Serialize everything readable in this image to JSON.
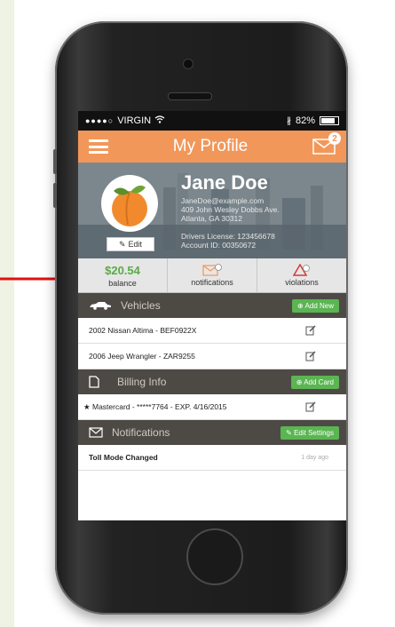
{
  "status_bar": {
    "signal": "●●●●○",
    "carrier": "VIRGIN",
    "battery": "82%"
  },
  "nav": {
    "title": "My Profile",
    "mail_badge": "2"
  },
  "profile": {
    "name": "Jane Doe",
    "email": "JaneDoe@example.com",
    "address_line1": "409 John Wesley Dobbs Ave.",
    "address_line2": "Atlanta, GA 30312",
    "license": "Drivers License: 123456678",
    "account": "Account ID: 00350672",
    "edit_label": "Edit"
  },
  "stats": [
    {
      "value": "$20.54",
      "label": "balance"
    },
    {
      "label": "notifications"
    },
    {
      "label": "violations"
    }
  ],
  "vehicles": {
    "title": "Vehicles",
    "button": "Add New",
    "items": [
      "2002 Nissan Altima  -  BEF0922X",
      "2006 Jeep Wrangler  -  ZAR9255"
    ]
  },
  "billing": {
    "title": "Billing Info",
    "button": "Add Card",
    "items": [
      "Mastercard  -  *****7764  -  EXP. 4/16/2015"
    ]
  },
  "notifications": {
    "title": "Notifications",
    "button": "Edit Settings",
    "items": [
      {
        "text": "Toll Mode Changed",
        "time": "1 day ago"
      }
    ]
  },
  "colors": {
    "accent": "#f2975a",
    "green": "#5bb552",
    "section_bg": "#4d4a45",
    "arrow": "#e01010"
  }
}
